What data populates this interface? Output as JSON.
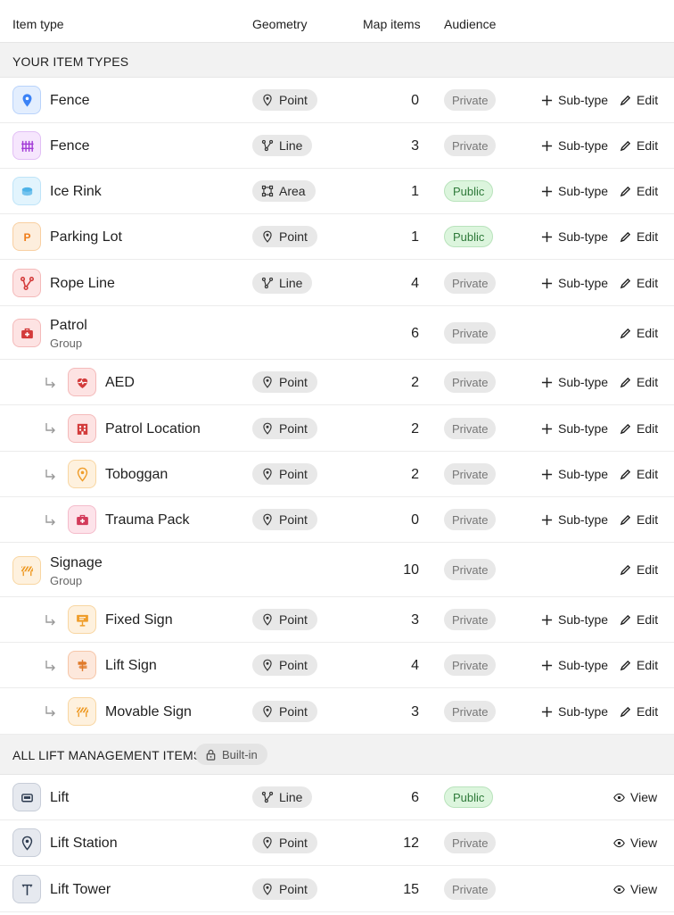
{
  "columns": {
    "item_type": "Item type",
    "geometry": "Geometry",
    "map_items": "Map items",
    "audience": "Audience"
  },
  "sections": {
    "yours": "YOUR ITEM TYPES",
    "lift": "ALL LIFT MANAGEMENT ITEMS",
    "builtin_badge": "Built-in"
  },
  "actions": {
    "subtype": "Sub-type",
    "edit": "Edit",
    "view": "View"
  },
  "rows": [
    {
      "name": "Fence",
      "geometry": "Point",
      "count": "0",
      "audience": "Private",
      "icon": "map-pin-icon",
      "color": "#3b82f6"
    },
    {
      "name": "Fence",
      "geometry": "Line",
      "count": "3",
      "audience": "Private",
      "icon": "fence-icon",
      "color": "#a23bd6"
    },
    {
      "name": "Ice Rink",
      "geometry": "Area",
      "count": "1",
      "audience": "Public",
      "icon": "ice-rink-icon",
      "color": "#4fb3e8"
    },
    {
      "name": "Parking Lot",
      "geometry": "Point",
      "count": "1",
      "audience": "Public",
      "icon": "parking-icon",
      "color": "#ef7d1a"
    },
    {
      "name": "Rope Line",
      "geometry": "Line",
      "count": "4",
      "audience": "Private",
      "icon": "rope-line-icon",
      "color": "#d33a3a"
    },
    {
      "name": "Patrol",
      "subtitle": "Group",
      "count": "6",
      "audience": "Private",
      "icon": "medical-bag-icon",
      "color": "#d33a3a"
    },
    {
      "name": "AED",
      "geometry": "Point",
      "count": "2",
      "audience": "Private",
      "icon": "heart-pulse-icon",
      "color": "#d33a3a"
    },
    {
      "name": "Patrol Location",
      "geometry": "Point",
      "count": "2",
      "audience": "Private",
      "icon": "building-icon",
      "color": "#d33a3a"
    },
    {
      "name": "Toboggan",
      "geometry": "Point",
      "count": "2",
      "audience": "Private",
      "icon": "location-icon",
      "color": "#ef9d2a"
    },
    {
      "name": "Trauma Pack",
      "geometry": "Point",
      "count": "0",
      "audience": "Private",
      "icon": "medical-kit-icon",
      "color": "#d33a5a"
    },
    {
      "name": "Signage",
      "subtitle": "Group",
      "count": "10",
      "audience": "Private",
      "icon": "barrier-icon",
      "color": "#ef9d2a"
    },
    {
      "name": "Fixed Sign",
      "geometry": "Point",
      "count": "3",
      "audience": "Private",
      "icon": "sign-board-icon",
      "color": "#ef9d2a"
    },
    {
      "name": "Lift Sign",
      "geometry": "Point",
      "count": "4",
      "audience": "Private",
      "icon": "signpost-icon",
      "color": "#e07a2a"
    },
    {
      "name": "Movable Sign",
      "geometry": "Point",
      "count": "3",
      "audience": "Private",
      "icon": "barrier-icon",
      "color": "#ef9d2a"
    },
    {
      "name": "Lift",
      "geometry": "Line",
      "count": "6",
      "audience": "Public",
      "icon": "gondola-icon",
      "color": "#2c3a4f"
    },
    {
      "name": "Lift Station",
      "geometry": "Point",
      "count": "12",
      "audience": "Private",
      "icon": "pin-icon",
      "color": "#2c3a4f"
    },
    {
      "name": "Lift Tower",
      "geometry": "Point",
      "count": "15",
      "audience": "Private",
      "icon": "tower-icon",
      "color": "#2c3a4f"
    }
  ]
}
